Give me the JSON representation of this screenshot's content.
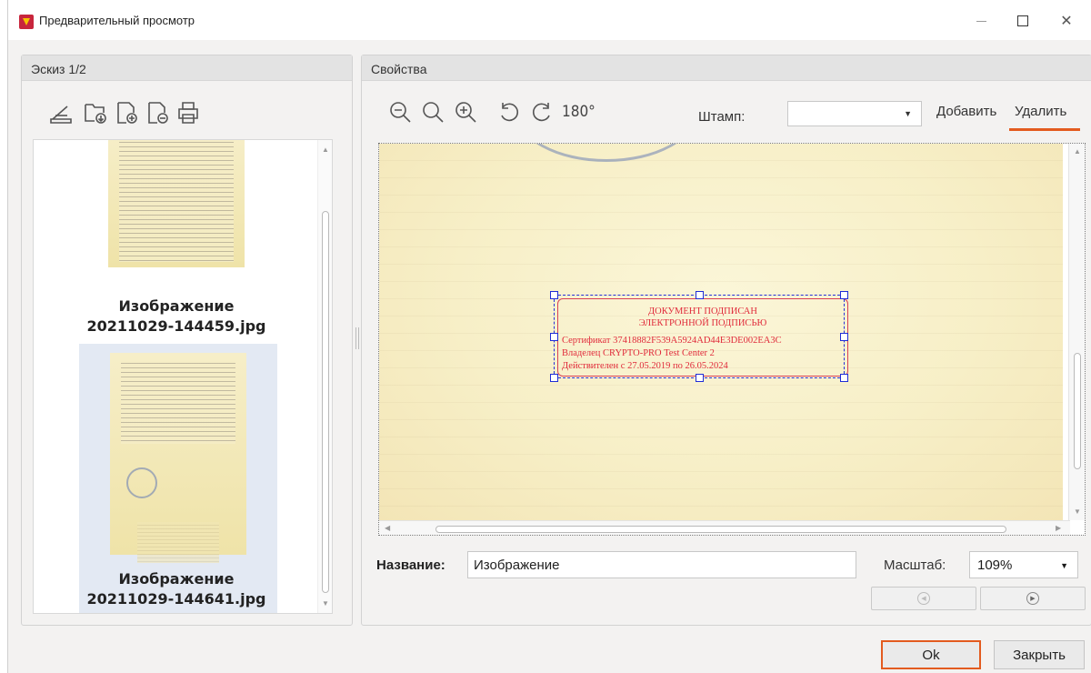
{
  "window": {
    "title": "Предварительный просмотр",
    "close_glyph": "✕"
  },
  "left_panel": {
    "header": "Эскиз 1/2",
    "toolbar": [
      {
        "icon": "scanner-icon",
        "label": "scan"
      },
      {
        "icon": "folder-open-icon",
        "label": "open"
      },
      {
        "icon": "add-page-icon",
        "label": "add page"
      },
      {
        "icon": "remove-page-icon",
        "label": "remove page"
      },
      {
        "icon": "printer-icon",
        "label": "print"
      }
    ],
    "thumbnails": [
      {
        "caption_line1": "Изображение",
        "caption_line2": "20211029-144459.jpg",
        "selected": false
      },
      {
        "caption_line1": "Изображение",
        "caption_line2": "20211029-144641.jpg",
        "selected": true
      }
    ]
  },
  "right_panel": {
    "header": "Свойства",
    "toolbar": [
      {
        "icon": "zoom-out-icon"
      },
      {
        "icon": "zoom-reset-icon"
      },
      {
        "icon": "zoom-in-icon"
      },
      {
        "icon": "rotate-left-icon"
      },
      {
        "icon": "rotate-right-icon"
      },
      {
        "icon": "rotate-180-icon",
        "label": "180°"
      }
    ],
    "stamp_label": "Штамп:",
    "stamp_value": "",
    "add_link": "Добавить",
    "delete_link": "Удалить",
    "stamp": {
      "title1": "ДОКУМЕНТ ПОДПИСАН",
      "title2": "ЭЛЕКТРОННОЙ ПОДПИСЬЮ",
      "cert": "Сертификат 37418882F539A5924AD44E3DE002EA3C",
      "owner": "Владелец CRYPTO-PRO Test Center 2",
      "valid": "Действителен с 27.05.2019 по 26.05.2024"
    },
    "name_label": "Название:",
    "name_value": "Изображение",
    "scale_label": "Масштаб:",
    "scale_value": "109%"
  },
  "buttons": {
    "ok": "Ok",
    "close": "Закрыть"
  },
  "colors": {
    "highlight": "#e35b1f",
    "stamp_red": "#e02a3a",
    "selection_blue": "#1f2cd6"
  }
}
